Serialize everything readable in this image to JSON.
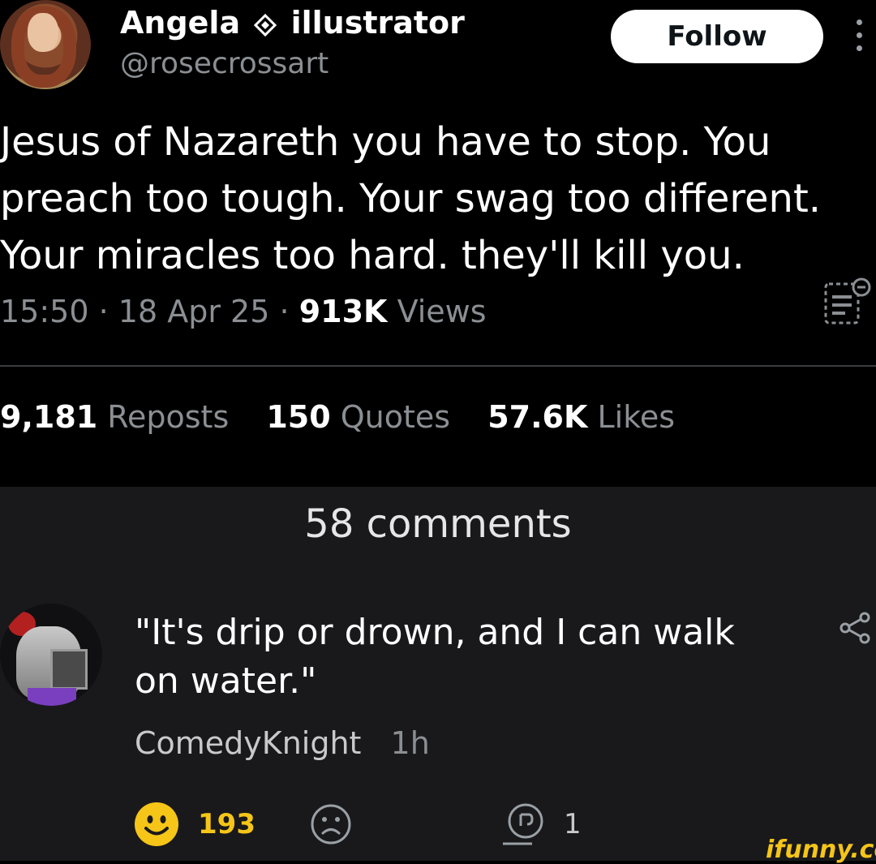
{
  "tweet": {
    "display_name": "Angela",
    "badge_icon": "diamond-outline-icon",
    "name_suffix": "illustrator",
    "handle": "@rosecrossart",
    "follow_label": "Follow",
    "text": "Jesus of Nazareth you have to stop. You preach too tough. Your swag too different. Your miracles too hard. they'll kill you.",
    "time": "15:50",
    "date": "18 Apr 25",
    "views_count": "913K",
    "views_label": "Views",
    "sep": "·",
    "stats": {
      "reposts_count": "9,181",
      "reposts_label": "Reposts",
      "quotes_count": "150",
      "quotes_label": "Quotes",
      "likes_count": "57.6K",
      "likes_label": "Likes"
    }
  },
  "comments_section": {
    "title": "58 comments",
    "comment": {
      "text": "\"It's drip or drown, and I can walk on water.\"",
      "author": "ComedyKnight",
      "time": "1h",
      "smile_count": "193",
      "reply_count": "1"
    }
  },
  "watermark": "ifunny.co",
  "colors": {
    "tweet_bg": "#000000",
    "comments_bg": "#19191b",
    "accent_yellow": "#f5c518"
  }
}
